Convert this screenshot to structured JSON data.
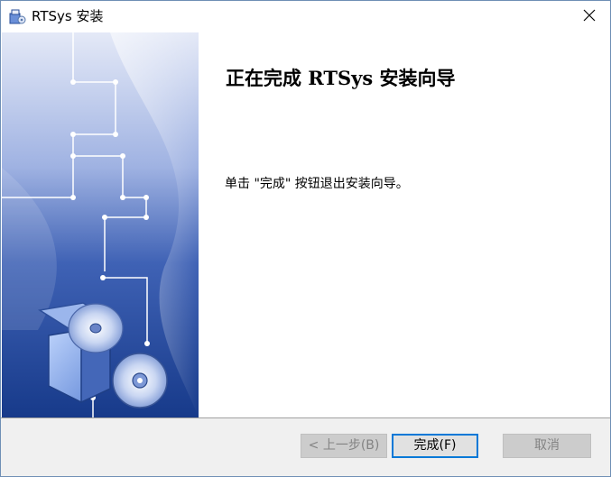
{
  "window": {
    "title": "RTSys 安装",
    "app_icon": "installer-box-icon",
    "close_icon": "close-icon"
  },
  "main": {
    "heading": "正在完成 RTSys 安装向导",
    "message": "单击 \"完成\" 按钮退出安装向导。"
  },
  "footer": {
    "back_label": "< 上一步(B)",
    "finish_label": "完成(F)",
    "cancel_label": "取消"
  },
  "colors": {
    "accent": "#0078d7",
    "side_dark": "#1a3f8f",
    "side_light": "#dfe6f7"
  }
}
